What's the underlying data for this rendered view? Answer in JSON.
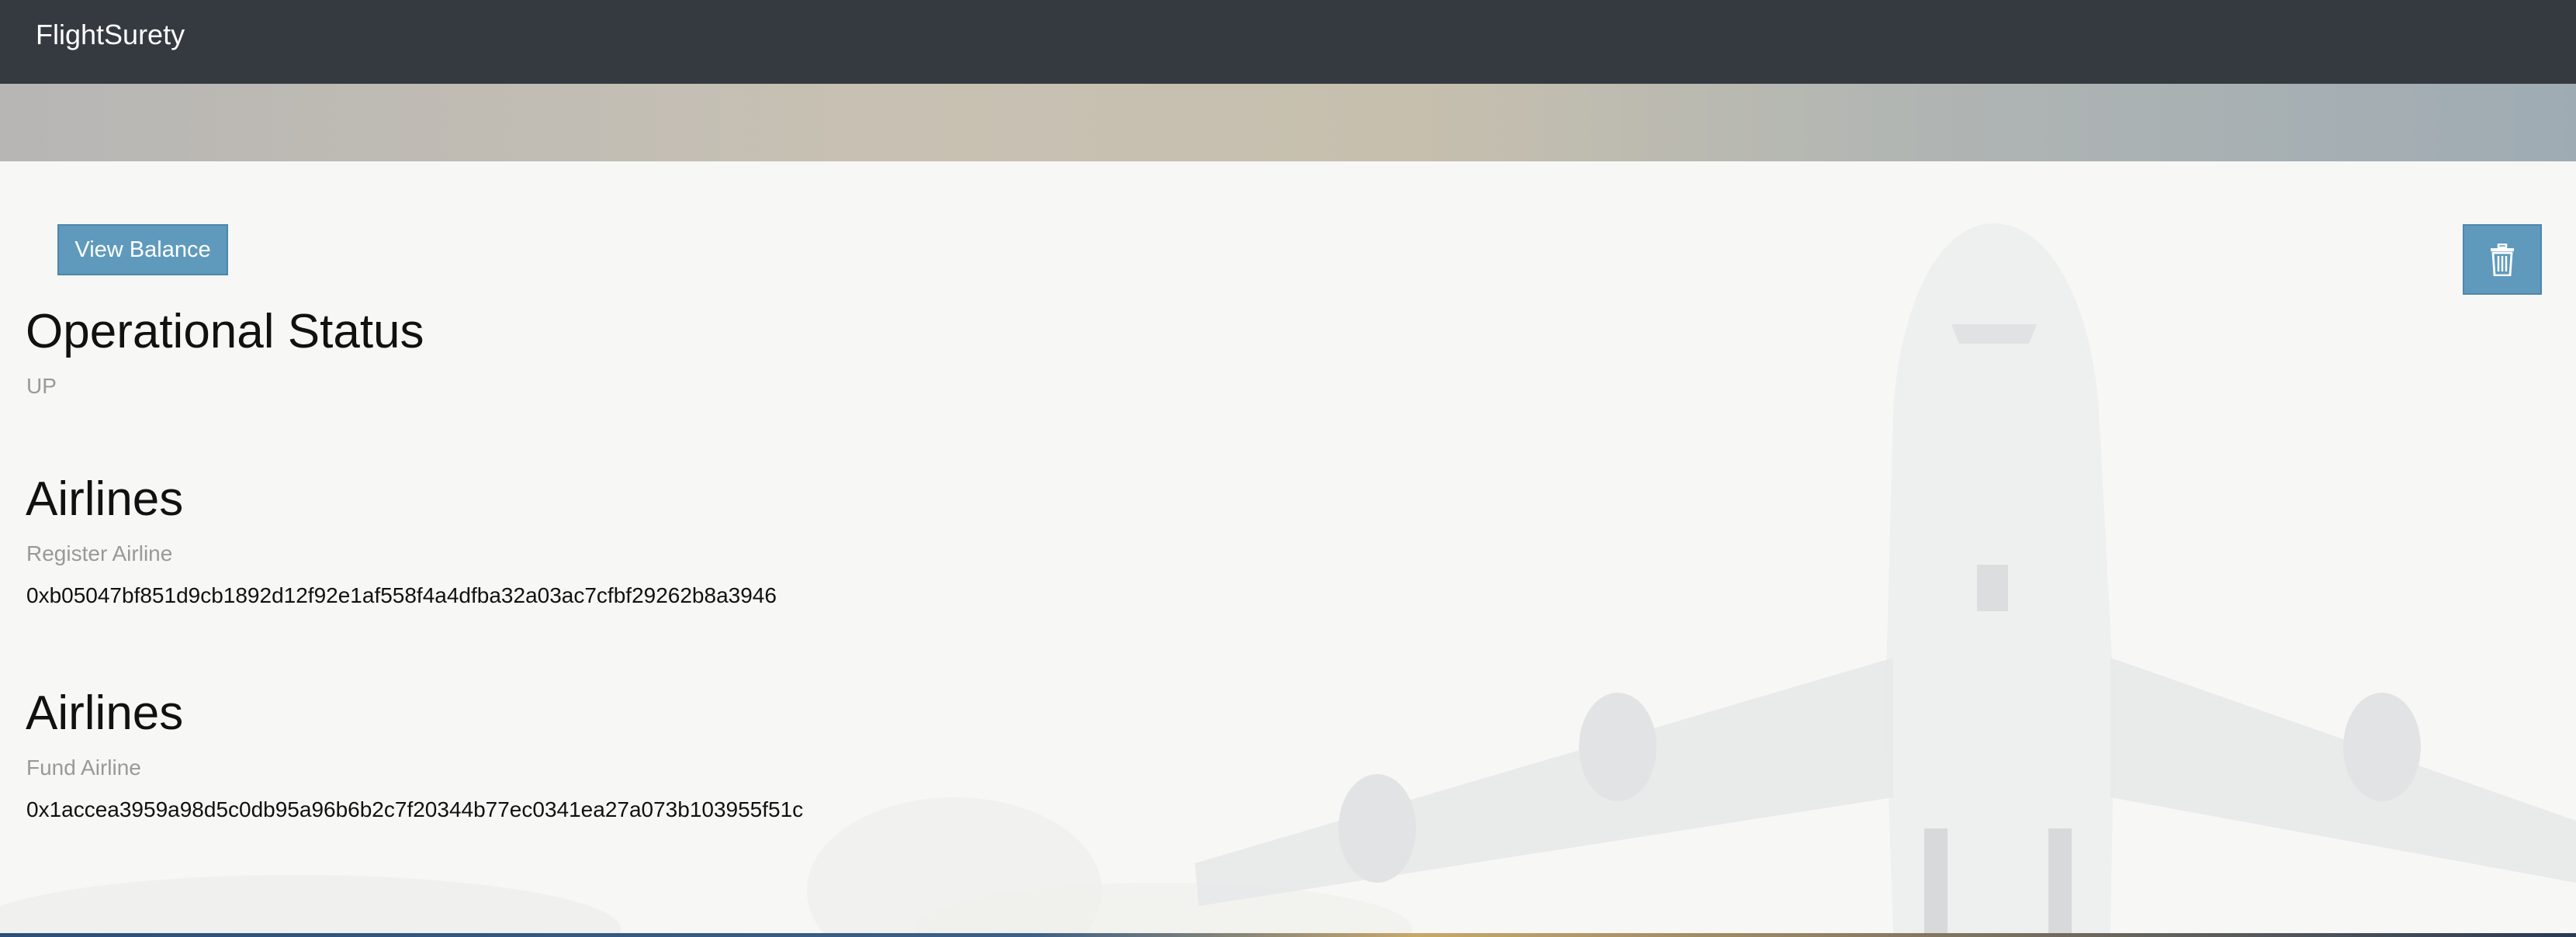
{
  "navbar": {
    "brand": "FlightSurety"
  },
  "toolbar": {
    "view_balance_label": "View Balance",
    "trash_icon": "trash-icon"
  },
  "operational": {
    "title": "Operational Status",
    "status": "UP"
  },
  "register_section": {
    "title": "Airlines",
    "subtitle": "Register Airline",
    "address": "0xb05047bf851d9cb1892d12f92e1af558f4a4dfba32a03ac7cfbf29262b8a3946"
  },
  "fund_section": {
    "title": "Airlines",
    "subtitle": "Fund Airline",
    "address": "0x1accea3959a98d5c0db95a96b6b2c7f20344b77ec0341ea27a073b103955f51c"
  },
  "colors": {
    "navbar": "#343a40",
    "button": "#5f9abd",
    "panel": "#f7f7f6",
    "muted_text": "#999999"
  }
}
